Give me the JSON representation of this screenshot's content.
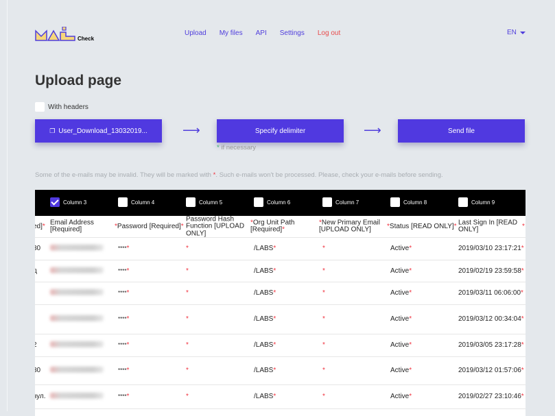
{
  "logo": {
    "text": "MAIL",
    "sub": "Check"
  },
  "nav": {
    "items": [
      "Upload",
      "My files",
      "API",
      "Settings"
    ],
    "logout": "Log out",
    "lang": "EN"
  },
  "page": {
    "title": "Upload page",
    "with_headers": "With headers",
    "with_headers_checked": false
  },
  "buttons": {
    "file": "User_Download_13032019...",
    "delimiter": "Specify delimiter",
    "send": "Send file",
    "delimiter_note": "if necessary"
  },
  "info": {
    "before": "Some of the e-mails may be invalid. They will be marked with ",
    "mark": "*",
    "after": ". Such e-mails won't be processed. Please, check your e-mails before sending."
  },
  "colors": {
    "accent": "#5039e0",
    "logout": "#e84b4b",
    "mark": "#f0333f"
  },
  "table": {
    "columns": [
      {
        "label": "Column 3",
        "checked": true
      },
      {
        "label": "Column 4",
        "checked": false
      },
      {
        "label": "Column 5",
        "checked": false
      },
      {
        "label": "Column 6",
        "checked": false
      },
      {
        "label": "Column 7",
        "checked": false
      },
      {
        "label": "Column 8",
        "checked": false
      },
      {
        "label": "Column 9",
        "checked": false
      }
    ],
    "header_row": [
      "ed]",
      "Email Address [Required]",
      "Password [Required]",
      "Password Hash Function [UPLOAD ONLY]",
      "Org Unit Path [Required]",
      "New Primary Email [UPLOAD ONLY]",
      "Status [READ ONLY]",
      "Last Sign In [READ ONLY]"
    ],
    "rows": [
      [
        "30",
        "",
        "****",
        "",
        "/LABS",
        "",
        "Active",
        "2019/03/10 23:17:21"
      ],
      [
        "д",
        "",
        "****",
        "",
        "/LABS",
        "",
        "Active",
        "2019/02/19 23:59:58"
      ],
      [
        "",
        "",
        "****",
        "",
        "/LABS",
        "",
        "Active",
        "2019/03/11 06:06:00"
      ],
      [
        "",
        "",
        "****",
        "",
        "/LABS",
        "",
        "Active",
        "2019/03/12 00:34:04"
      ],
      [
        "2",
        "",
        "****",
        "",
        "/LABS",
        "",
        "Active",
        "2019/03/05 23:17:28"
      ],
      [
        "30",
        "",
        "****",
        "",
        "/LABS",
        "",
        "Active",
        "2019/03/12 01:57:06"
      ],
      [
        "вул.",
        "",
        "****",
        "",
        "/LABS",
        "",
        "Active",
        "2019/02/27 23:10:46"
      ]
    ]
  }
}
